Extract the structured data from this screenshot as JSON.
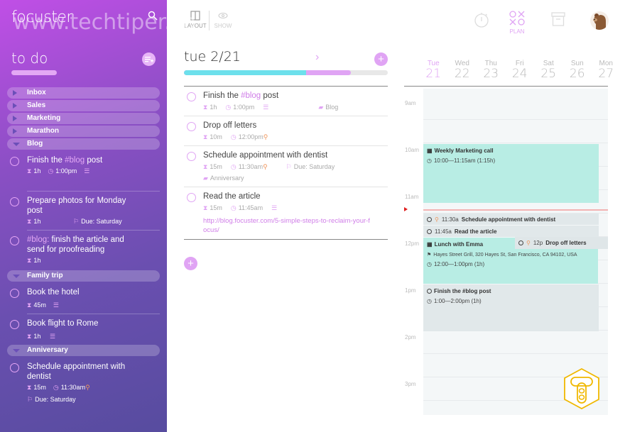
{
  "app": {
    "logo": "focuster",
    "watermark": "www.techtiper.co"
  },
  "sidebar": {
    "title": "to do",
    "groups_collapsed": [
      "Inbox",
      "Sales",
      "Marketing",
      "Marathon"
    ],
    "blog": {
      "label": "Blog",
      "tasks": [
        {
          "title_pre": "Finish the ",
          "hashtag": "#blog",
          "title_post": " post",
          "duration": "1h",
          "time": "1:00pm",
          "has_notes": true
        },
        {
          "title": "Prepare photos for Monday post",
          "duration": "1h",
          "due": "Due: Saturday"
        },
        {
          "hashtag": "#blog:",
          "title_post": " finish the article and send for proofreading",
          "duration": "1h"
        }
      ]
    },
    "family_trip": {
      "label": "Family trip",
      "tasks": [
        {
          "title": "Book the hotel",
          "duration": "45m",
          "has_notes": true
        },
        {
          "title": "Book flight to Rome",
          "duration": "1h",
          "has_notes": true
        }
      ]
    },
    "anniversary": {
      "label": "Anniversary",
      "tasks": [
        {
          "title": "Schedule appointment with dentist",
          "duration": "15m",
          "time": "11:30am",
          "pinned": true,
          "due": "Due: Saturday"
        }
      ]
    }
  },
  "toolbar": {
    "layout_label": "LAYOUT",
    "show_label": "SHOW",
    "plan_label": "PLAN"
  },
  "day": {
    "title": "tue 2/21",
    "progress": {
      "done_fraction": 0.6,
      "planned_fraction": 0.82
    },
    "tasks": [
      {
        "title_pre": "Finish the ",
        "hashtag": "#blog",
        "title_post": " post",
        "duration": "1h",
        "time": "1:00pm",
        "has_notes": true,
        "list": "Blog"
      },
      {
        "title": "Drop off letters",
        "duration": "10m",
        "time": "12:00pm",
        "pinned": true
      },
      {
        "title": "Schedule appointment with dentist",
        "duration": "15m",
        "time": "11:30am",
        "pinned": true,
        "due": "Due: Saturday",
        "list": "Anniversary"
      },
      {
        "title": "Read the article",
        "duration": "15m",
        "time": "11:45am",
        "has_notes": true,
        "link": "http://blog.focuster.com/5-simple-steps-to-reclaim-your-focus/"
      }
    ]
  },
  "calendar": {
    "days": [
      {
        "name": "Tue",
        "num": "21",
        "active": true
      },
      {
        "name": "Wed",
        "num": "22"
      },
      {
        "name": "Thu",
        "num": "23"
      },
      {
        "name": "Fri",
        "num": "24"
      },
      {
        "name": "Sat",
        "num": "25"
      },
      {
        "name": "Sun",
        "num": "26"
      },
      {
        "name": "Mon",
        "num": "27"
      }
    ],
    "hours": [
      "9am",
      "10am",
      "11am",
      "12pm",
      "1pm",
      "2pm",
      "3pm"
    ],
    "events": {
      "marketing": {
        "title": "Weekly Marketing call",
        "time": "10:00—11:15am  (1:15h)"
      },
      "dentist": {
        "time": "11:30a",
        "title": "Schedule appointment with dentist"
      },
      "article": {
        "time": "11:45a",
        "title": "Read the article"
      },
      "letters": {
        "time": "12p",
        "title": "Drop off letters"
      },
      "lunch": {
        "title": "Lunch with Emma",
        "location": "Hayes Street Grill, 320 Hayes St, San Francisco, CA 94102, USA",
        "time": "12:00—1:00pm  (1h)"
      },
      "blogpost": {
        "title": "Finish the #blog post",
        "time": "1:00—2:00pm  (1h)"
      }
    }
  },
  "colors": {
    "accent": "#e0a4f4",
    "progress_done": "#6de0ec",
    "event_teal": "#b8ede4",
    "event_grey": "#e1e8ea",
    "pin": "#f0965c"
  }
}
